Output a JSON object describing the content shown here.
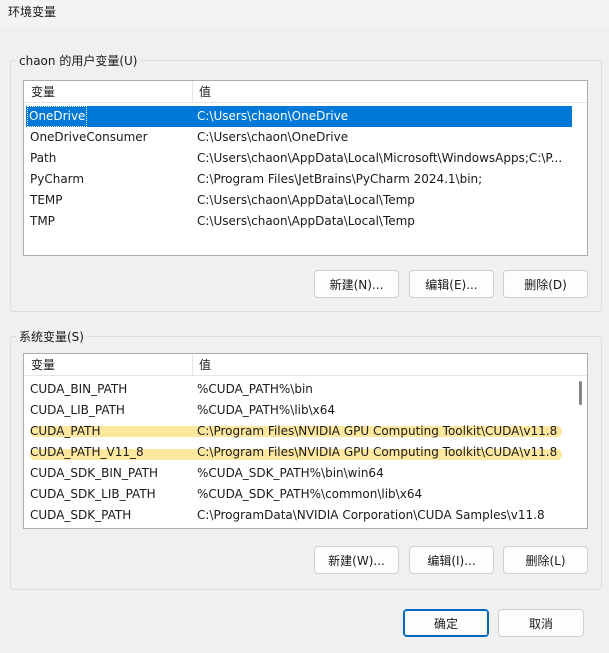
{
  "window": {
    "title": "环境变量"
  },
  "user_vars": {
    "group_label": "chaon 的用户变量(U)",
    "columns": [
      "变量",
      "值"
    ],
    "rows": [
      {
        "name": "OneDrive",
        "value": "C:\\Users\\chaon\\OneDrive",
        "selected": true
      },
      {
        "name": "OneDriveConsumer",
        "value": "C:\\Users\\chaon\\OneDrive"
      },
      {
        "name": "Path",
        "value": "C:\\Users\\chaon\\AppData\\Local\\Microsoft\\WindowsApps;C:\\P..."
      },
      {
        "name": "PyCharm",
        "value": "C:\\Program Files\\JetBrains\\PyCharm 2024.1\\bin;"
      },
      {
        "name": "TEMP",
        "value": "C:\\Users\\chaon\\AppData\\Local\\Temp"
      },
      {
        "name": "TMP",
        "value": "C:\\Users\\chaon\\AppData\\Local\\Temp"
      }
    ],
    "buttons": {
      "new": "新建(N)...",
      "edit": "编辑(E)...",
      "delete": "删除(D)"
    }
  },
  "system_vars": {
    "group_label": "系统变量(S)",
    "columns": [
      "变量",
      "值"
    ],
    "rows": [
      {
        "name": "CUDA_BIN_PATH",
        "value": "%CUDA_PATH%\\bin"
      },
      {
        "name": "CUDA_LIB_PATH",
        "value": "%CUDA_PATH%\\lib\\x64"
      },
      {
        "name": "CUDA_PATH",
        "value": "C:\\Program Files\\NVIDIA GPU Computing Toolkit\\CUDA\\v11.8",
        "highlighted": true
      },
      {
        "name": "CUDA_PATH_V11_8",
        "value": "C:\\Program Files\\NVIDIA GPU Computing Toolkit\\CUDA\\v11.8",
        "highlighted": true
      },
      {
        "name": "CUDA_SDK_BIN_PATH",
        "value": "%CUDA_SDK_PATH%\\bin\\win64"
      },
      {
        "name": "CUDA_SDK_LIB_PATH",
        "value": "%CUDA_SDK_PATH%\\common\\lib\\x64"
      },
      {
        "name": "CUDA_SDK_PATH",
        "value": "C:\\ProgramData\\NVIDIA Corporation\\CUDA Samples\\v11.8"
      }
    ],
    "buttons": {
      "new": "新建(W)...",
      "edit": "编辑(I)...",
      "delete": "删除(L)"
    }
  },
  "footer": {
    "ok": "确定",
    "cancel": "取消"
  },
  "colors": {
    "selection": "#0078d7",
    "highlight_marker": "#fbe38e",
    "default_button_border": "#0067c0"
  }
}
